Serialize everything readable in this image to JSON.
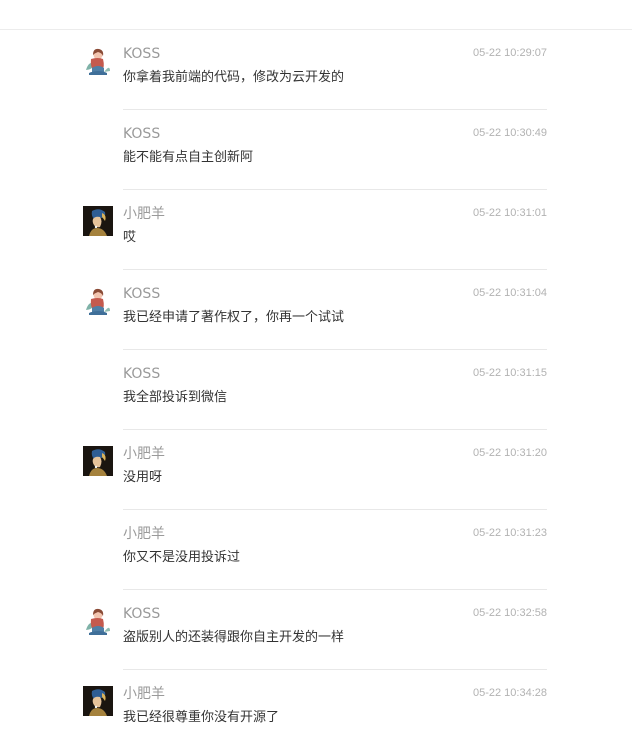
{
  "messages": [
    {
      "sender": "KOSS",
      "time": "05-22 10:29:07",
      "content": "你拿着我前端的代码，修改为云开发的",
      "avatar": "koss-avatar"
    },
    {
      "sender": "KOSS",
      "time": "05-22 10:30:49",
      "content": "能不能有点自主创新阿",
      "avatar": "none"
    },
    {
      "sender": "小肥羊",
      "time": "05-22 10:31:01",
      "content": "哎",
      "avatar": "pearl-earring-avatar"
    },
    {
      "sender": "KOSS",
      "time": "05-22 10:31:04",
      "content": "我已经申请了著作权了，你再一个试试",
      "avatar": "koss-avatar"
    },
    {
      "sender": "KOSS",
      "time": "05-22 10:31:15",
      "content": "我全部投诉到微信",
      "avatar": "none"
    },
    {
      "sender": "小肥羊",
      "time": "05-22 10:31:20",
      "content": "没用呀",
      "avatar": "pearl-earring-avatar"
    },
    {
      "sender": "小肥羊",
      "time": "05-22 10:31:23",
      "content": "你又不是没用投诉过",
      "avatar": "none"
    },
    {
      "sender": "KOSS",
      "time": "05-22 10:32:58",
      "content": "盗版别人的还装得跟你自主开发的一样",
      "avatar": "koss-avatar"
    },
    {
      "sender": "小肥羊",
      "time": "05-22 10:34:28",
      "content": "我已经很尊重你没有开源了",
      "avatar": "pearl-earring-avatar"
    }
  ]
}
